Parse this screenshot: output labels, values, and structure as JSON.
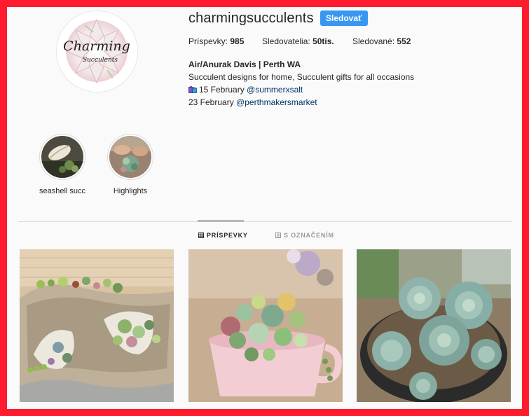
{
  "profile": {
    "username": "charmingsucculents",
    "follow_label": "Sledovať",
    "avatar_logo_line1": "Charming",
    "avatar_logo_line2": "Succulents"
  },
  "stats": [
    {
      "label": "Príspevky:",
      "value": "985"
    },
    {
      "label": "Sledovatelia:",
      "value": "50tis."
    },
    {
      "label": "Sledované:",
      "value": "552"
    }
  ],
  "bio": {
    "name": "Air/Anurak Davis | Perth WA",
    "line1": "Succulent designs for home, Succulent gifts for all occasions",
    "event1_date": "15 February",
    "event1_handle": "@summerxsalt",
    "event2_date": "23 February",
    "event2_handle": "@perthmakersmarket"
  },
  "highlights": [
    {
      "label": "seashell succ"
    },
    {
      "label": "Highlights"
    }
  ],
  "tabs": [
    {
      "label": "PRÍSPEVKY",
      "icon": "grid-icon",
      "active": true
    },
    {
      "label": "S OZNAČENÍM",
      "icon": "tag-icon",
      "active": false
    }
  ],
  "colors": {
    "frame_border": "#ff1a2e",
    "follow_button": "#3897f0",
    "link": "#003569",
    "tab_inactive": "#999999"
  }
}
